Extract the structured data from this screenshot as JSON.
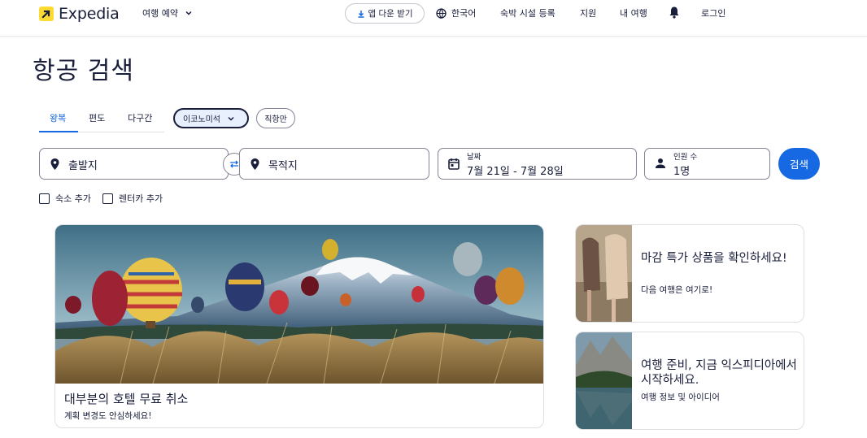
{
  "header": {
    "logo_text": "Expedia",
    "trip_menu": "여행 예약",
    "app_button": "앱 다운 받기",
    "language": "한국어",
    "list_property": "숙박 시설 등록",
    "support": "지원",
    "my_trips": "내 여행",
    "login": "로그인"
  },
  "page_title": "항공 검색",
  "tabs": [
    "왕복",
    "편도",
    "다구간"
  ],
  "cabin_class": "이코노미석",
  "nonstop": "직항만",
  "search": {
    "origin": "출발지",
    "destination": "목적지",
    "dates_label": "날짜",
    "dates_value": "7월 21일 - 7월 28일",
    "travelers_label": "인원 수",
    "travelers_value": "1명",
    "search_button": "검색"
  },
  "addons": [
    "숙소 추가",
    "렌터카 추가"
  ],
  "cards": {
    "main": {
      "title": "대부분의 호텔 무료 취소",
      "subtitle": "계획 변경도 안심하세요!"
    },
    "side1": {
      "title": "마감 특가 상품을 확인하세요!",
      "subtitle": "다음 여행은 여기로!"
    },
    "side2": {
      "title": "여행 준비, 지금 익스피디아에서 시작하세요.",
      "subtitle": "여행 정보 및 아이디어"
    }
  },
  "colors": {
    "brand_blue": "#1668e3",
    "logo_yellow": "#fddb32",
    "text": "#191e3b"
  }
}
